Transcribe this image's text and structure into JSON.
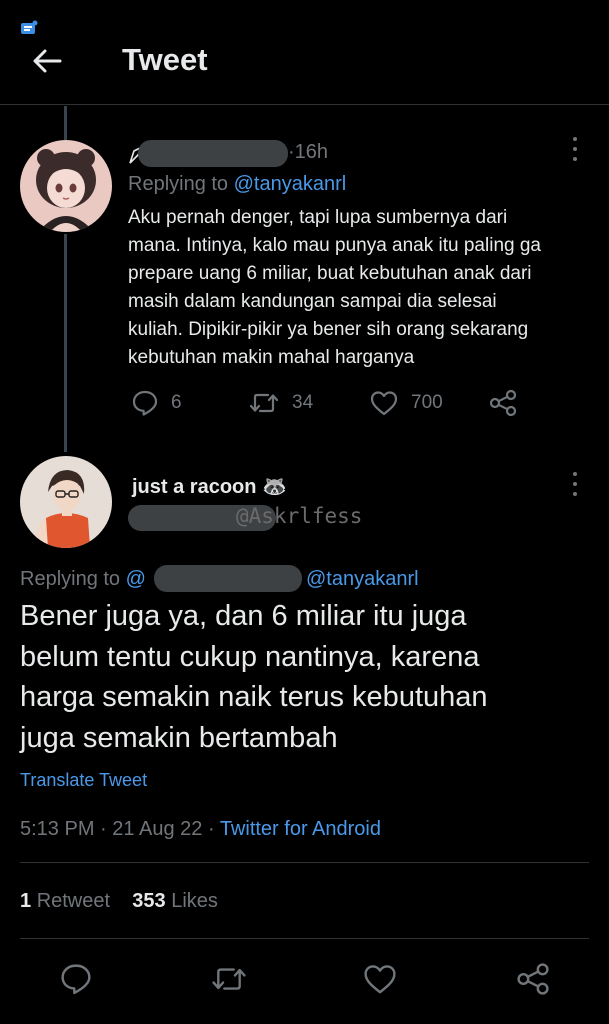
{
  "header": {
    "title": "Tweet"
  },
  "parent_tweet": {
    "time": "16h",
    "replying_to_prefix": "Replying to",
    "replying_to_handle": "@tanyakanrl",
    "text": "Aku pernah denger, tapi lupa sumbernya dari\nmana. Intinya, kalo mau punya anak itu paling ga\nprepare uang 6 miliar, buat kebutuhan anak dari\nmasih dalam kandungan sampai dia selesai\nkuliah. Dipikir-pikir ya bener sih orang sekarang\nkebutuhan makin mahal harganya",
    "replies": "6",
    "retweets": "34",
    "likes": "700"
  },
  "main_tweet": {
    "display_name": "just a racoon",
    "name_emoji": "🦝",
    "handle_overlay": "@Askrlfess",
    "replying_to_prefix": "Replying to",
    "replying_to_at": "@",
    "replying_to_handle": "@tanyakanrl",
    "text": "Bener juga ya, dan 6 miliar itu juga\nbelum tentu cukup nantinya, karena\nharga semakin naik terus kebutuhan\njuga semakin bertambah",
    "translate_label": "Translate Tweet",
    "time": "5:13 PM",
    "date": "21 Aug 22",
    "separator": "·",
    "source": "Twitter for Android",
    "retweet_count": "1",
    "retweet_label": "Retweet",
    "like_count": "353",
    "like_label": "Likes"
  },
  "colors": {
    "background": "#000000",
    "text_primary": "#e7e9ea",
    "text_secondary": "#71767b",
    "accent": "#4a99e9",
    "divider": "#2f3336"
  },
  "icons": {
    "back": "arrow-left-icon",
    "more": "more-vertical-icon",
    "reply": "reply-icon",
    "retweet": "retweet-icon",
    "like": "heart-icon",
    "share": "share-icon"
  }
}
